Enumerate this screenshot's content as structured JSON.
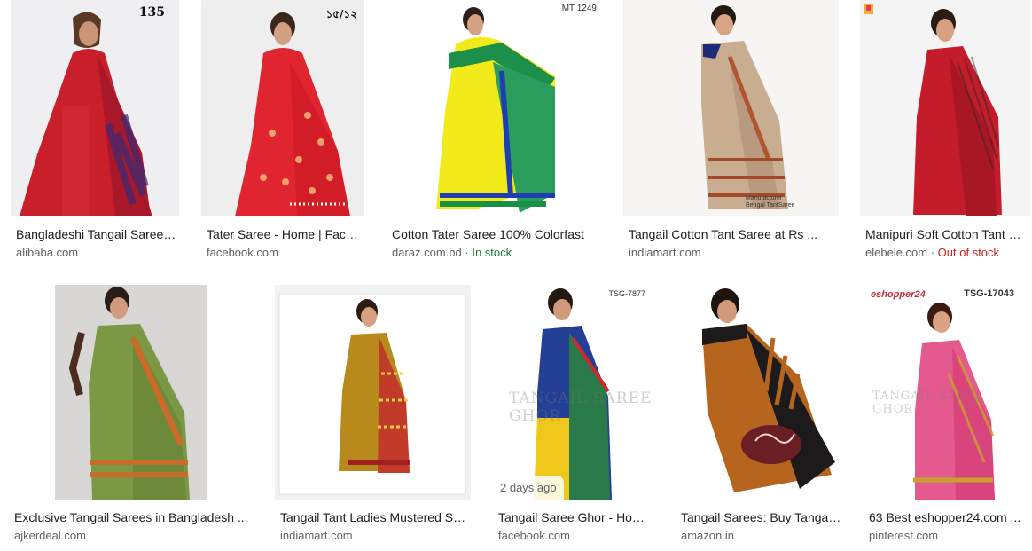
{
  "results": [
    {
      "title": "Bangladeshi Tangail Saree Hand Loom Wholesale ...",
      "source": "alibaba.com",
      "status": "",
      "overlay": "135"
    },
    {
      "title": "Tater Saree - Home | Facebook",
      "source": "facebook.com",
      "status": "",
      "overlay": "১৫/১২"
    },
    {
      "title": "Cotton Tater Saree 100% Colorfast",
      "source": "daraz.com.bd",
      "status": "In stock",
      "overlay": "MT 1249"
    },
    {
      "title": "Tangail Cotton Tant Saree at Rs ...",
      "source": "indiamart.com",
      "status": "",
      "overlay": "Manufacturer Bengal TantSaree"
    },
    {
      "title": "Manipuri Soft Cotton Tant Saree ...",
      "source": "elebele.com",
      "status": "Out of stock",
      "overlay": ""
    },
    {
      "title": "Exclusive Tangail Sarees in Bangladesh ...",
      "source": "ajkerdeal.com",
      "status": "",
      "overlay": ""
    },
    {
      "title": "Tangail Tant Ladies Mustered Saree ...",
      "source": "indiamart.com",
      "status": "",
      "overlay": ""
    },
    {
      "title": "Tangail Saree Ghor - Home | Facebook",
      "source": "facebook.com",
      "status": "",
      "overlay": "TSG-7877",
      "watermark": "TANGAIL SAREE GHOR",
      "time_badge": "2 days ago"
    },
    {
      "title": "Tangail Sarees: Buy Tangail ...",
      "source": "amazon.in",
      "status": "",
      "overlay": ""
    },
    {
      "title": "63 Best eshopper24.com ...",
      "source": "pinterest.com",
      "status": "",
      "overlay": "TSG-17043",
      "brand": "eshopper24",
      "watermark": "TANGAIL SAREE GHOR"
    }
  ],
  "colors": {
    "title": "#202124",
    "source": "#5f6368",
    "in_stock": "#188038",
    "out_of_stock": "#c5221f"
  }
}
